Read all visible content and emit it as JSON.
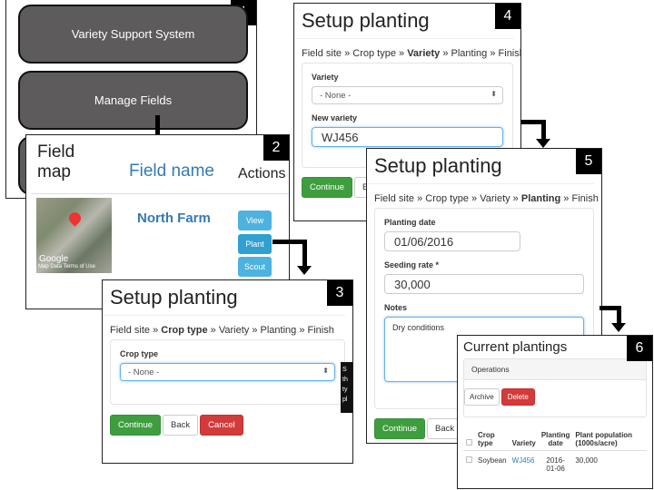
{
  "panel1": {
    "number": "1",
    "buttons": [
      "Variety Support System",
      "Manage Fields"
    ]
  },
  "panel2": {
    "number": "2",
    "headers": {
      "map": "Field\nmap",
      "name": "Field name",
      "actions": "Actions"
    },
    "row": {
      "name": "North Farm",
      "map_attribution": "Map Data  Terms of Use",
      "map_logo": "Google",
      "actions": [
        "View",
        "Plant",
        "Scout"
      ]
    }
  },
  "panel3": {
    "number": "3",
    "title": "Setup planting",
    "breadcrumb": [
      "Field site",
      "Crop type",
      "Variety",
      "Planting",
      "Finish"
    ],
    "active_step": "Crop type",
    "field_label": "Crop type",
    "select_value": "- None -",
    "tooltip_fragments": [
      "S",
      "th",
      "ty",
      "pl"
    ],
    "buttons": {
      "continue": "Continue",
      "back": "Back",
      "cancel": "Cancel"
    }
  },
  "panel4": {
    "number": "4",
    "title": "Setup planting",
    "active_step": "Variety",
    "variety_label": "Variety",
    "variety_value": "- None -",
    "new_variety_label": "New variety",
    "new_variety_value": "WJ456",
    "buttons": {
      "continue": "Continue",
      "back": "Back"
    }
  },
  "panel5": {
    "number": "5",
    "title": "Setup planting",
    "active_step": "Planting",
    "planting_date_label": "Planting date",
    "planting_date_value": "01/06/2016",
    "seeding_rate_label": "Seeding rate *",
    "seeding_rate_value": "30,000",
    "notes_label": "Notes",
    "notes_value": "Dry conditions",
    "buttons": {
      "continue": "Continue",
      "back": "Back"
    }
  },
  "panel6": {
    "number": "6",
    "title": "Current plantings",
    "operations_label": "Operations",
    "buttons": {
      "archive": "Archive",
      "delete": "Delete"
    },
    "columns": [
      "Crop type",
      "Variety",
      "Planting date",
      "Plant population (1000s/acre)"
    ],
    "rows": [
      {
        "crop": "Soybean",
        "variety": "WJ456",
        "date": "2016-01-06",
        "population": "30,000"
      }
    ]
  },
  "colors": {
    "primary_blue": "#337ab7",
    "success": "#3e9e3e",
    "danger": "#d33a3a",
    "info": "#4db3de",
    "dark_button": "#5d5b5b"
  }
}
